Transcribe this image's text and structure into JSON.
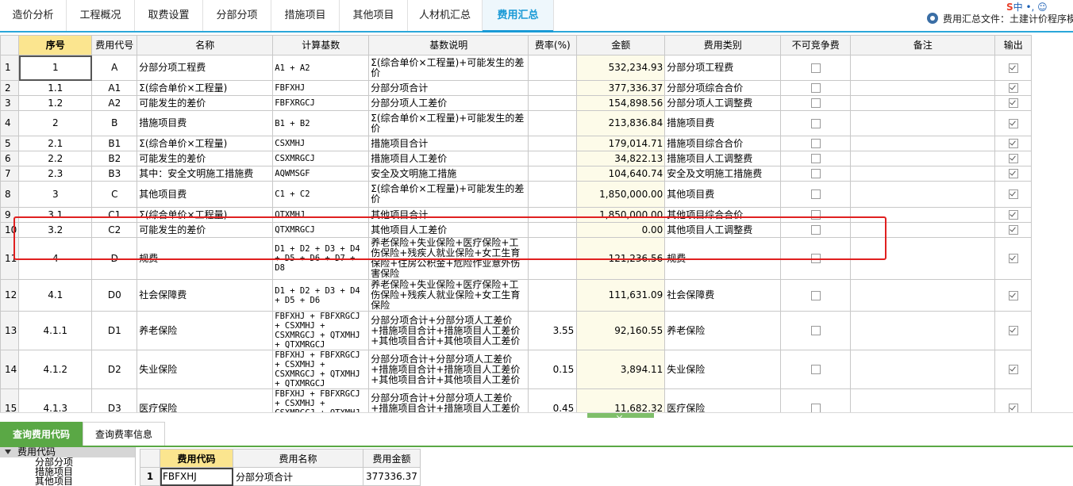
{
  "tabs": [
    {
      "label": "造价分析",
      "active": false
    },
    {
      "label": "工程概况",
      "active": false
    },
    {
      "label": "取费设置",
      "active": false
    },
    {
      "label": "分部分项",
      "active": false
    },
    {
      "label": "措施项目",
      "active": false
    },
    {
      "label": "其他项目",
      "active": false
    },
    {
      "label": "人材机汇总",
      "active": false
    },
    {
      "label": "费用汇总",
      "active": true
    }
  ],
  "file_label": "费用汇总文件：土建计价程序模",
  "ime_indicator": {
    "logo": "S",
    "text": "中 •, ☺"
  },
  "columns": [
    "",
    "序号",
    "费用代号",
    "名称",
    "计算基数",
    "基数说明",
    "费率(%)",
    "金额",
    "费用类别",
    "不可竞争费",
    "备注",
    "输出"
  ],
  "rows": [
    {
      "rn": "1",
      "seq": "1",
      "code": "A",
      "name": "分部分项工程费",
      "base": "A1 + A2",
      "desc": "Σ(综合单价×工程量)+可能发生的差价",
      "rate": "",
      "amount": "532,234.93",
      "category": "分部分项工程费",
      "noncompete": false,
      "remark": "",
      "output": true
    },
    {
      "rn": "2",
      "seq": "1.1",
      "code": "A1",
      "name": "Σ(综合单价×工程量)",
      "base": "FBFXHJ",
      "desc": "分部分项合计",
      "rate": "",
      "amount": "377,336.37",
      "category": "分部分项综合合价",
      "noncompete": false,
      "remark": "",
      "output": true
    },
    {
      "rn": "3",
      "seq": "1.2",
      "code": "A2",
      "name": "可能发生的差价",
      "base": "FBFXRGCJ",
      "desc": "分部分项人工差价",
      "rate": "",
      "amount": "154,898.56",
      "category": "分部分项人工调整费",
      "noncompete": false,
      "remark": "",
      "output": true
    },
    {
      "rn": "4",
      "seq": "2",
      "code": "B",
      "name": "措施项目费",
      "base": "B1 + B2",
      "desc": "Σ(综合单价×工程量)+可能发生的差价",
      "rate": "",
      "amount": "213,836.84",
      "category": "措施项目费",
      "noncompete": false,
      "remark": "",
      "output": true
    },
    {
      "rn": "5",
      "seq": "2.1",
      "code": "B1",
      "name": "Σ(综合单价×工程量)",
      "base": "CSXMHJ",
      "desc": "措施项目合计",
      "rate": "",
      "amount": "179,014.71",
      "category": "措施项目综合合价",
      "noncompete": false,
      "remark": "",
      "output": true
    },
    {
      "rn": "6",
      "seq": "2.2",
      "code": "B2",
      "name": "可能发生的差价",
      "base": "CSXMRGCJ",
      "desc": "措施项目人工差价",
      "rate": "",
      "amount": "34,822.13",
      "category": "措施项目人工调整费",
      "noncompete": false,
      "remark": "",
      "output": true
    },
    {
      "rn": "7",
      "seq": "2.3",
      "code": "B3",
      "name": "其中：安全文明施工措施费",
      "base": "AQWMSGF",
      "desc": "安全及文明施工措施",
      "rate": "",
      "amount": "104,640.74",
      "category": "安全及文明施工措施费",
      "noncompete": false,
      "remark": "",
      "output": true
    },
    {
      "rn": "8",
      "seq": "3",
      "code": "C",
      "name": "其他项目费",
      "base": "C1 + C2",
      "desc": "Σ(综合单价×工程量)+可能发生的差价",
      "rate": "",
      "amount": "1,850,000.00",
      "category": "其他项目费",
      "noncompete": false,
      "remark": "",
      "output": true
    },
    {
      "rn": "9",
      "seq": "3.1",
      "code": "C1",
      "name": "Σ(综合单价×工程量)",
      "base": "QTXMHJ",
      "desc": "其他项目合计",
      "rate": "",
      "amount": "1,850,000.00",
      "category": "其他项目综合合价",
      "noncompete": false,
      "remark": "",
      "output": true
    },
    {
      "rn": "10",
      "seq": "3.2",
      "code": "C2",
      "name": "可能发生的差价",
      "base": "QTXMRGCJ",
      "desc": "其他项目人工差价",
      "rate": "",
      "amount": "0.00",
      "category": "其他项目人工调整费",
      "noncompete": false,
      "remark": "",
      "output": true
    },
    {
      "rn": "11",
      "seq": "4",
      "code": "D",
      "name": "规费",
      "base": "D1 + D2 + D3 + D4 + D5 + D6 + D7 + D8",
      "desc": "养老保险+失业保险+医疗保险+工伤保险+残疾人就业保险+女工生育保险+住房公积金+危险作业意外伤害保险",
      "rate": "",
      "amount": "121,236.56",
      "category": "规费",
      "noncompete": false,
      "remark": "",
      "output": true
    },
    {
      "rn": "12",
      "seq": "4.1",
      "code": "D0",
      "name": "社会保障费",
      "base": "D1 + D2 + D3 + D4 + D5 + D6",
      "desc": "养老保险+失业保险+医疗保险+工伤保险+残疾人就业保险+女工生育保险",
      "rate": "",
      "amount": "111,631.09",
      "category": "社会保障费",
      "noncompete": false,
      "remark": "",
      "output": true
    },
    {
      "rn": "13",
      "seq": "4.1.1",
      "code": "D1",
      "name": "养老保险",
      "base": "FBFXHJ + FBFXRGCJ + CSXMHJ + CSXMRGCJ + QTXMHJ + QTXMRGCJ",
      "desc": "分部分项合计+分部分项人工差价+措施项目合计+措施项目人工差价+其他项目合计+其他项目人工差价",
      "rate": "3.55",
      "amount": "92,160.55",
      "category": "养老保险",
      "noncompete": false,
      "remark": "",
      "output": true
    },
    {
      "rn": "14",
      "seq": "4.1.2",
      "code": "D2",
      "name": "失业保险",
      "base": "FBFXHJ + FBFXRGCJ + CSXMHJ + CSXMRGCJ + QTXMHJ + QTXMRGCJ",
      "desc": "分部分项合计+分部分项人工差价+措施项目合计+措施项目人工差价+其他项目合计+其他项目人工差价",
      "rate": "0.15",
      "amount": "3,894.11",
      "category": "失业保险",
      "noncompete": false,
      "remark": "",
      "output": true
    },
    {
      "rn": "15",
      "seq": "4.1.3",
      "code": "D3",
      "name": "医疗保险",
      "base": "FBFXHJ + FBFXRGCJ + CSXMHJ + CSXMRGCJ + QTXMHJ + QTXMRGCJ",
      "desc": "分部分项合计+分部分项人工差价+措施项目合计+措施项目人工差价+其他项目合计+其他项目人工差价",
      "rate": "0.45",
      "amount": "11,682.32",
      "category": "医疗保险",
      "noncompete": false,
      "remark": "",
      "output": true
    }
  ],
  "bottom_tabs": [
    {
      "label": "查询费用代码",
      "active": true
    },
    {
      "label": "查询费率信息",
      "active": false
    }
  ],
  "tree": {
    "root": "费用代码",
    "children": [
      "分部分项",
      "措施项目",
      "其他项目"
    ]
  },
  "code_table": {
    "columns": [
      "",
      "费用代码",
      "费用名称",
      "费用金额"
    ],
    "rows": [
      {
        "rn": "1",
        "code": "FBFXHJ",
        "name": "分部分项合计",
        "amount": "377336.37"
      }
    ]
  },
  "colors": {
    "accent": "#1a9ad6",
    "highlight_header": "#fbe58f",
    "green_tab": "#5aa845",
    "annotation_box": "#e02020"
  }
}
